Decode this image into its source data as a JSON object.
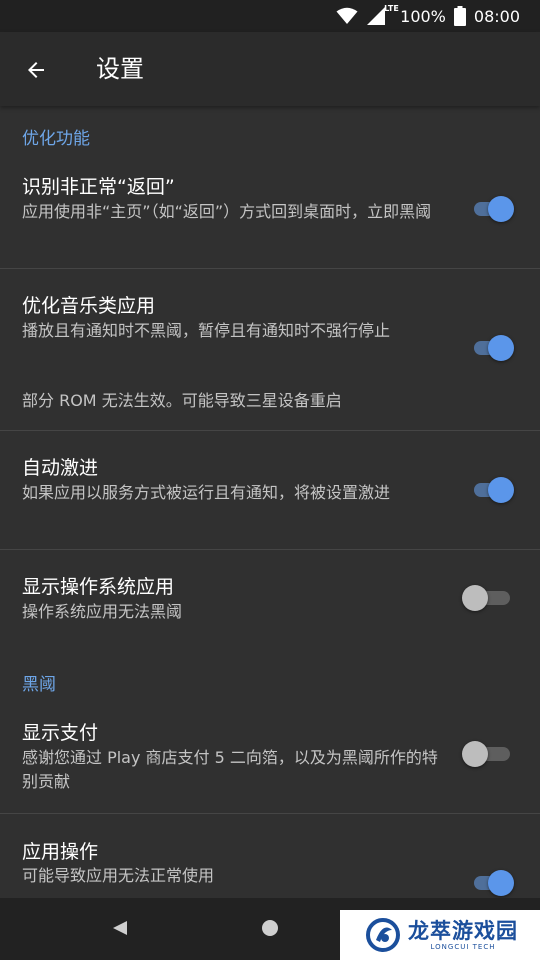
{
  "status_bar": {
    "network_label": "LTE",
    "battery_percent": "100%",
    "time": "08:00"
  },
  "app_bar": {
    "title": "设置"
  },
  "sections": [
    {
      "header": "优化功能",
      "prefs": [
        {
          "title": "识别非正常“返回”",
          "summary": "应用使用非“主页”（如“返回”）方式回到桌面时，立即黑阈",
          "enabled": true
        },
        {
          "title": "优化音乐类应用",
          "summary": "播放且有通知时不黑阈，暂停且有通知时不强行停止",
          "note": "部分 ROM 无法生效。可能导致三星设备重启",
          "enabled": true
        },
        {
          "title": "自动激进",
          "summary": "如果应用以服务方式被运行且有通知，将被设置激进",
          "enabled": true
        },
        {
          "title": "显示操作系统应用",
          "summary": "操作系统应用无法黑阈",
          "enabled": false
        }
      ]
    },
    {
      "header": "黑阈",
      "prefs": [
        {
          "title": "显示支付",
          "summary": "感谢您通过 Play 商店支付 5 二向箔，以及为黑阈所作的特别贡献",
          "enabled": false
        },
        {
          "title": "应用操作",
          "summary": "可能导致应用无法正常使用",
          "enabled": true
        }
      ]
    }
  ],
  "watermark": {
    "main": "龙萃游戏园",
    "sub": "LONGCUI TECH"
  },
  "colors": {
    "accent": "#5b96ea",
    "section_header": "#6ea6e8",
    "background": "#303030"
  }
}
